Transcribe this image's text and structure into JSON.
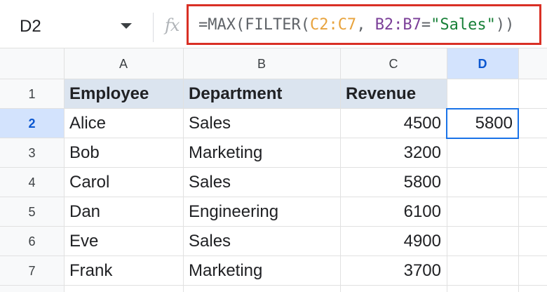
{
  "name_box": {
    "value": "D2"
  },
  "formula_bar": {
    "fx_label": "fx",
    "tokens": [
      {
        "text": "=MAX(FILTER(",
        "kind": "fn"
      },
      {
        "text": "C2:C7",
        "kind": "range1"
      },
      {
        "text": ", ",
        "kind": "fn"
      },
      {
        "text": "B2:B7",
        "kind": "range2"
      },
      {
        "text": "=",
        "kind": "fn"
      },
      {
        "text": "\"Sales\"",
        "kind": "string"
      },
      {
        "text": "))",
        "kind": "fn"
      }
    ],
    "highlight_color": "#d93025"
  },
  "columns": [
    "A",
    "B",
    "C",
    "D"
  ],
  "selected_column": "D",
  "rows": [
    "1",
    "2",
    "3",
    "4",
    "5",
    "6",
    "7"
  ],
  "selected_row": "2",
  "table": {
    "headers": [
      "Employee",
      "Department",
      "Revenue",
      ""
    ],
    "data": [
      [
        "Alice",
        "Sales",
        "4500",
        "5800"
      ],
      [
        "Bob",
        "Marketing",
        "3200",
        ""
      ],
      [
        "Carol",
        "Sales",
        "5800",
        ""
      ],
      [
        "Dan",
        "Engineering",
        "6100",
        ""
      ],
      [
        "Eve",
        "Sales",
        "4900",
        ""
      ],
      [
        "Frank",
        "Marketing",
        "3700",
        ""
      ]
    ]
  },
  "colors": {
    "header_fill": "#dbe4ef",
    "selection": "#1a73e8",
    "range1": "#e8a33d",
    "range2": "#7b3f98",
    "string": "#188038"
  }
}
